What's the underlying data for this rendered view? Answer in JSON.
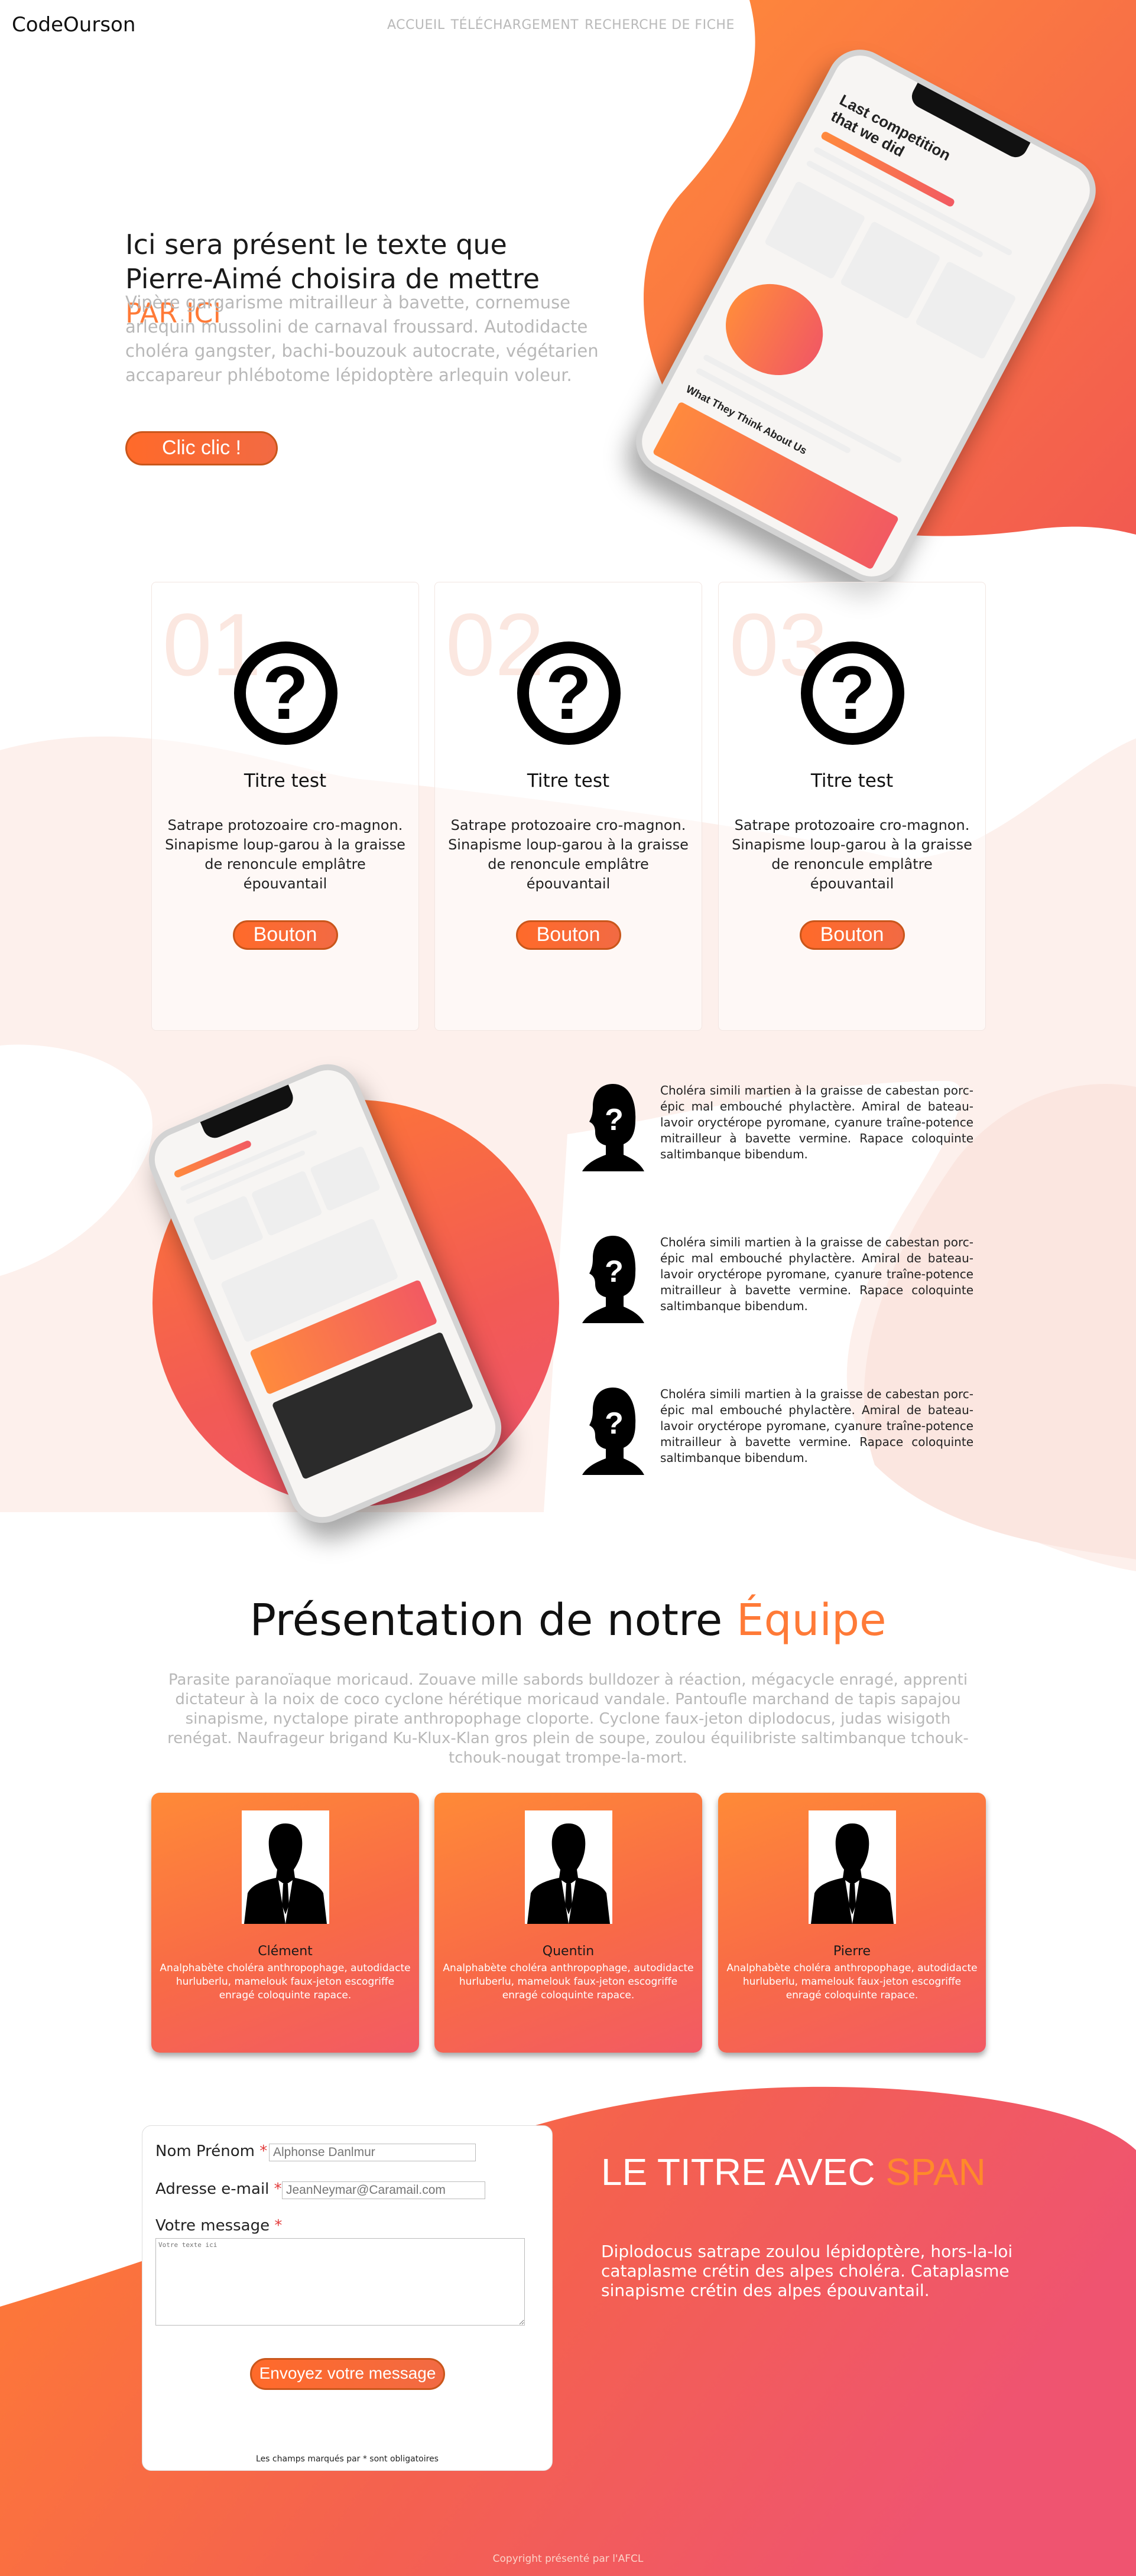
{
  "header": {
    "logo": "CodeOurson",
    "nav": [
      "ACCUEIL",
      "TÉLÉCHARGEMENT",
      "RECHERCHE DE FICHE"
    ]
  },
  "hero": {
    "title_main": "Ici sera présent le texte que Pierre-Aimé choisira de mettre ",
    "title_accent": "PAR ICI",
    "text": "Vipère gargarisme mitrailleur à bavette, cornemuse arlequin mussolini de carnaval froussard. Autodidacte choléra gangster, bachi-bouzouk autocrate, végétarien accapareur phlébotome lépidoptère arlequin voleur.",
    "button": "Clic clic !",
    "phone_heading_1": "Last competition",
    "phone_heading_2": "that we did",
    "phone_subheading": "What They Think About Us"
  },
  "cards": [
    {
      "num": "01",
      "title": "Titre test",
      "text": "Satrape protozoaire cro-magnon. Sinapisme loup-garou à la graisse de renoncule emplâtre épouvantail",
      "button": "Bouton"
    },
    {
      "num": "02",
      "title": "Titre test",
      "text": "Satrape protozoaire cro-magnon. Sinapisme loup-garou à la graisse de renoncule emplâtre épouvantail",
      "button": "Bouton"
    },
    {
      "num": "03",
      "title": "Titre test",
      "text": "Satrape protozoaire cro-magnon. Sinapisme loup-garou à la graisse de renoncule emplâtre épouvantail",
      "button": "Bouton"
    }
  ],
  "features": [
    {
      "text": "Choléra simili martien à la graisse de cabestan porc-épic mal embouché phylactère. Amiral de bateau-lavoir oryctérope pyromane, cyanure traîne-potence mitrailleur à bavette vermine. Rapace coloquinte saltimbanque bibendum."
    },
    {
      "text": "Choléra simili martien à la graisse de cabestan porc-épic mal embouché phylactère. Amiral de bateau-lavoir oryctérope pyromane, cyanure traîne-potence mitrailleur à bavette vermine. Rapace coloquinte saltimbanque bibendum."
    },
    {
      "text": "Choléra simili martien à la graisse de cabestan porc-épic mal embouché phylactère. Amiral de bateau-lavoir oryctérope pyromane, cyanure traîne-potence mitrailleur à bavette vermine. Rapace coloquinte saltimbanque bibendum."
    }
  ],
  "team": {
    "title_main": "Présentation de notre ",
    "title_accent": "Équipe",
    "text": "Parasite paranoïaque moricaud. Zouave mille sabords bulldozer à réaction, mégacycle enragé, apprenti dictateur à la noix de coco cyclone hérétique moricaud vandale. Pantoufle marchand de tapis sapajou sinapisme, nyctalope pirate anthropophage cloporte. Cyclone faux-jeton diplodocus, judas wisigoth renégat. Naufrageur brigand Ku-Klux-Klan gros plein de soupe, zoulou équilibriste saltimbanque tchouk-tchouk-nougat trompe-la-mort.",
    "members": [
      {
        "name": "Clément",
        "text": "Analphabète choléra anthropophage, autodidacte hurluberlu, mamelouk faux-jeton escogriffe enragé coloquinte rapace."
      },
      {
        "name": "Quentin",
        "text": "Analphabète choléra anthropophage, autodidacte hurluberlu, mamelouk faux-jeton escogriffe enragé coloquinte rapace."
      },
      {
        "name": "Pierre",
        "text": "Analphabète choléra anthropophage, autodidacte hurluberlu, mamelouk faux-jeton escogriffe enragé coloquinte rapace."
      }
    ]
  },
  "contact": {
    "name_label": "Nom Prénom",
    "name_placeholder": "Alphonse Danlmur",
    "email_label": "Adresse e-mail",
    "email_placeholder": "JeanNeymar@Caramail.com",
    "message_label": "Votre message",
    "message_placeholder": "Votre texte ici",
    "required_mark": "*",
    "send_button": "Envoyez votre message",
    "note": "Les champs marqués par * sont obligatoires",
    "title_main": "LE TITRE AVEC ",
    "title_accent": "SPAN",
    "text": "Diplodocus satrape zoulou lépidoptère, hors-la-loi cataplasme crétin des alpes choléra. Cataplasme sinapisme crétin des alpes épouvantail."
  },
  "footer": {
    "text": "Copyright présenté par l'AFCL"
  },
  "colors": {
    "accent": "#ff7a37",
    "gradient_start": "#ff7f32",
    "gradient_end": "#f0546d",
    "muted_text": "#b8b8b8"
  }
}
